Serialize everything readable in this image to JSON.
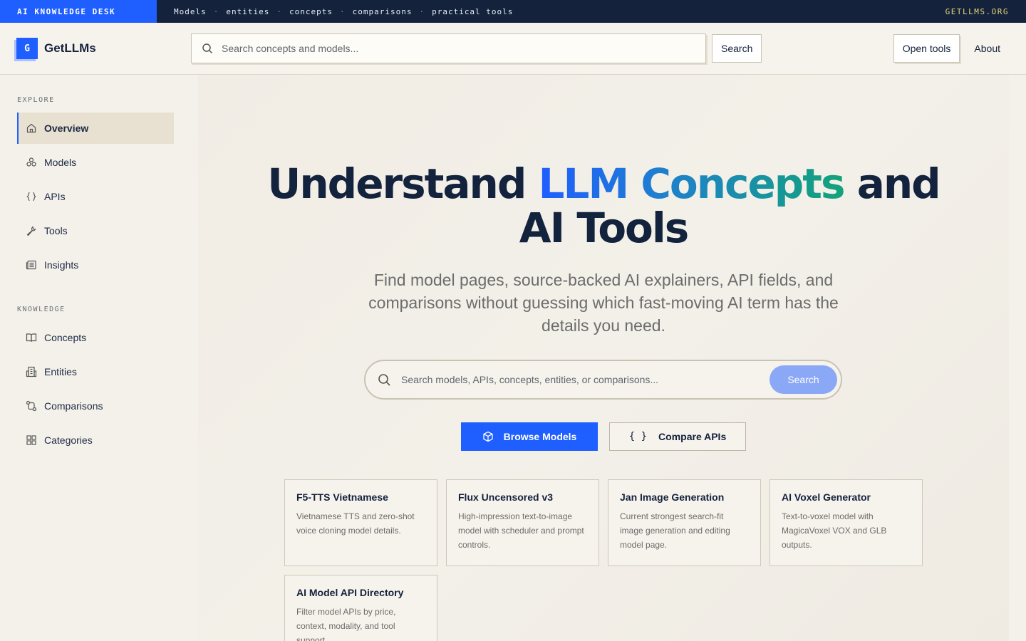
{
  "topbar": {
    "desk": "AI KNOWLEDGE DESK",
    "links": [
      "Models",
      "entities",
      "concepts",
      "comparisons",
      "practical tools"
    ],
    "site": "GETLLMS.ORG"
  },
  "header": {
    "logo_letter": "G",
    "brand": "GetLLMs",
    "search_placeholder": "Search concepts and models...",
    "search_button": "Search",
    "open_tools": "Open tools",
    "about": "About"
  },
  "sidebar": {
    "explore_title": "EXPLORE",
    "explore": [
      {
        "label": "Overview",
        "icon": "home-icon"
      },
      {
        "label": "Models",
        "icon": "models-icon"
      },
      {
        "label": "APIs",
        "icon": "braces-icon"
      },
      {
        "label": "Tools",
        "icon": "wrench-icon"
      },
      {
        "label": "Insights",
        "icon": "newspaper-icon"
      }
    ],
    "knowledge_title": "KNOWLEDGE",
    "knowledge": [
      {
        "label": "Concepts",
        "icon": "book-icon"
      },
      {
        "label": "Entities",
        "icon": "building-icon"
      },
      {
        "label": "Comparisons",
        "icon": "compare-icon"
      },
      {
        "label": "Categories",
        "icon": "grid-icon"
      }
    ]
  },
  "hero": {
    "title_pre": "Understand ",
    "title_highlight": "LLM Concepts",
    "title_post": " and",
    "title_line2": "AI Tools",
    "subtitle": "Find model pages, source-backed AI explainers, API fields, and comparisons without guessing which fast-moving AI term has the details you need.",
    "search_placeholder": "Search models, APIs, concepts, entities, or comparisons...",
    "search_button": "Search",
    "browse_models": "Browse Models",
    "compare_apis_icon": "{ }",
    "compare_apis": "Compare APIs"
  },
  "cards": [
    {
      "title": "F5-TTS Vietnamese",
      "desc": "Vietnamese TTS and zero-shot voice cloning model details."
    },
    {
      "title": "Flux Uncensored v3",
      "desc": "High-impression text-to-image model with scheduler and prompt controls."
    },
    {
      "title": "Jan Image Generation",
      "desc": "Current strongest search-fit image generation and editing model page."
    },
    {
      "title": "AI Voxel Generator",
      "desc": "Text-to-voxel model with MagicaVoxel VOX and GLB outputs."
    },
    {
      "title": "AI Model API Directory",
      "desc": "Filter model APIs by price, context, modality, and tool support."
    }
  ],
  "colors": {
    "accent": "#1f5eff",
    "navy": "#14233b",
    "gradient_end": "#12a37a"
  }
}
